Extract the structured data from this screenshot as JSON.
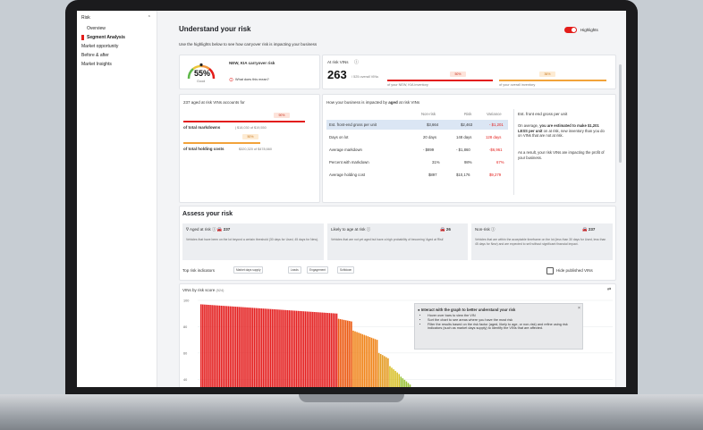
{
  "sidebar": {
    "header": "Risk",
    "items": [
      {
        "label": "Overview"
      },
      {
        "label": "Segment Analysis"
      },
      {
        "label": "Market opportunity"
      },
      {
        "label": "Before & after"
      },
      {
        "label": "Market Insights"
      }
    ]
  },
  "header": {
    "title": "Understand your risk",
    "subtitle": "Use the highlights below to see how carryover risk is impacting your business",
    "toggle_label": "Highlights"
  },
  "gauge_card": {
    "value": "55%",
    "rating": "Good",
    "title": "NEW, KIA carryover risk",
    "link": "What does this mean?"
  },
  "vins_card": {
    "label": "At risk VINs",
    "value": "263",
    "sub": "/ 525 overall VINs",
    "pct1": "50%",
    "pct1_caption": "of your NEW, KIA inventory",
    "pct2": "36%",
    "pct2_caption": "of your overall inventory"
  },
  "aged_card": {
    "title": "237 aged at risk VINs accounts for",
    "pct1": "90%",
    "line1_label": "of total markdowns",
    "line1_sub": "| $18,030 of $19,550",
    "pct2": "50%",
    "line2_label": "of total holding costs",
    "line2_sub": "$320,320 of $478,660"
  },
  "impact_card": {
    "title_pre": "How your business is impacted by",
    "title_bold": "aged",
    "title_post": "at risk VINs",
    "columns": [
      "Non-risk",
      "Risk",
      "Variance"
    ],
    "rows": [
      {
        "label": "Est. front-end gross per unit",
        "nonrisk": "$3,664",
        "risk": "$2,463",
        "variance": "- $1,201"
      },
      {
        "label": "Days on lot",
        "nonrisk": "20 days",
        "risk": "148 days",
        "variance": "128 days"
      },
      {
        "label": "Average markdown",
        "nonrisk": "- $899",
        "risk": "- $1,860",
        "variance": "-$6,961"
      },
      {
        "label": "Percent with markdown",
        "nonrisk": "31%",
        "risk": "98%",
        "variance": "67%"
      },
      {
        "label": "Average holding cost",
        "nonrisk": "$897",
        "risk": "$10,176",
        "variance": "$9,279"
      }
    ],
    "side_title": "Est. front end gross per unit",
    "side_text1": "On average,",
    "side_bold": "you are estimated to make $1,201 LESS per unit",
    "side_text2": "on at risk, new inventory than you do on VINs that are not at risk.",
    "side_text3": "As a result, your risk VINs are impacting the profit of your business."
  },
  "assess": {
    "title": "Assess your risk",
    "cards": [
      {
        "label": "Aged at risk",
        "count": "237",
        "desc": "Vehicles that have been on the lot beyond a certain threshold (30 days for Used, 45 days for New)."
      },
      {
        "label": "Likely to age at risk",
        "count": "26",
        "desc": "Vehicles that are not yet aged but have a high probability of becoming 'Aged at Risk'"
      },
      {
        "label": "Non-risk",
        "count": "237",
        "desc": "Vehicles that are within the acceptable timeframe on the lot (less than 30 days for Used, less than 45 days for New) and are expected to sell without significant financial impact."
      }
    ],
    "indicators_label": "Top risk indicators",
    "chips": [
      "Market days supply",
      "Leads",
      "Engagement",
      "Softdown"
    ],
    "hide_label": "Hide published VINs"
  },
  "chart": {
    "title": "VINs by risk score",
    "count": "(524)",
    "tooltip_title": "Interact with the graph to better understand your risk",
    "tooltip_items": [
      "Hover over bars to view the VIN",
      "Sort the chart to see areas where you have the most risk",
      "Filter the results based on the risk factor (aged, likely to age, or non-risk) and refine using risk indicators (such as market days supply) to identify the VINs that are affected."
    ]
  },
  "chart_data": {
    "type": "bar",
    "title": "VINs by risk score",
    "y_ticks": [
      100,
      80,
      60,
      40
    ],
    "ylim": [
      30,
      100
    ],
    "series": [
      {
        "color": "#e41e1e",
        "count": 75,
        "from": 97,
        "to": 90
      },
      {
        "color": "#ec5a12",
        "count": 8,
        "from": 86,
        "to": 84
      },
      {
        "color": "#f08419",
        "count": 14,
        "from": 77,
        "to": 70
      },
      {
        "color": "#e59c24",
        "count": 6,
        "from": 60,
        "to": 56
      },
      {
        "color": "#d8c02a",
        "count": 6,
        "from": 50,
        "to": 44
      },
      {
        "color": "#9bc43b",
        "count": 6,
        "from": 42,
        "to": 36
      }
    ]
  },
  "colors": {
    "accent": "#e31d1a",
    "orange": "#f2a33a",
    "highlight_row": "#dbe6f4"
  }
}
